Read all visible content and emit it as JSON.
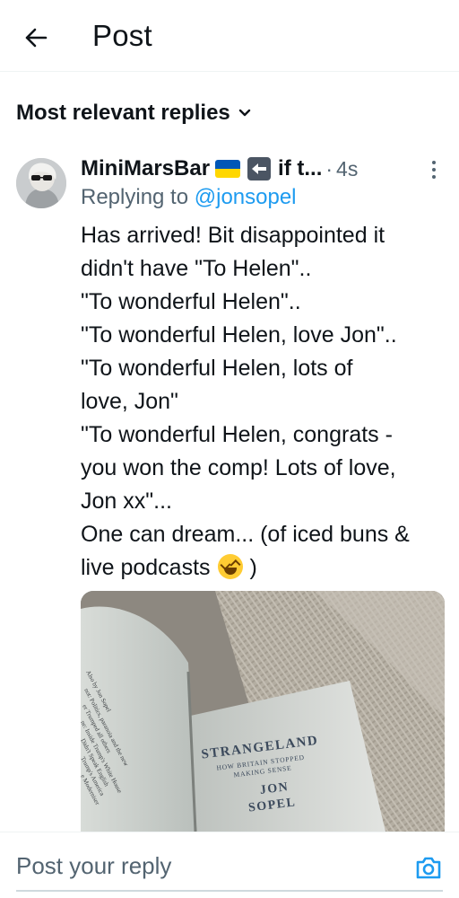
{
  "header": {
    "title": "Post",
    "back_icon": "arrow-left-icon"
  },
  "sort": {
    "label": "Most relevant replies",
    "icon": "chevron-down-icon"
  },
  "reply": {
    "author_name": "MiniMarsBar",
    "flag_colors": {
      "top": "#0057b7",
      "bottom": "#ffd700"
    },
    "badge_icon": "left-arrow-emoji-icon",
    "name_suffix": "if t...",
    "separator": "·",
    "time": "4s",
    "replying_prefix": "Replying to",
    "replying_handle": "@jonsopel",
    "text_lines": [
      "Has arrived! Bit disappointed it",
      "didn't have \"To Helen\"..",
      "\"To wonderful Helen\"..",
      "\"To wonderful Helen, love Jon\"..",
      "\"To wonderful Helen, lots of",
      "love, Jon\"",
      "\"To wonderful Helen, congrats -",
      "you won the comp! Lots of love,",
      "Jon xx\"...",
      "One can dream... (of iced buns &",
      "live podcasts"
    ],
    "text_end": ")",
    "emoji": "laughing-squint-emoji",
    "media": {
      "book_title": "STRANGELAND",
      "book_subtitle_1": "HOW BRITAIN STOPPED",
      "book_subtitle_2": "MAKING SENSE",
      "author_1": "JON",
      "author_2": "SOPEL",
      "left_page_lines": [
        "Also by Jon Sopel",
        "not: Politics, paranoia and the new",
        "er Trumped all others",
        "ne: Inside Trump's White House",
        "Didn't Speak English",
        "Trump's America",
        "e Moderniser"
      ]
    }
  },
  "compose": {
    "placeholder": "Post your reply",
    "camera_icon": "camera-icon"
  },
  "colors": {
    "accent": "#1d9bf0",
    "secondary_text": "#536471",
    "primary_text": "#0f1419"
  }
}
